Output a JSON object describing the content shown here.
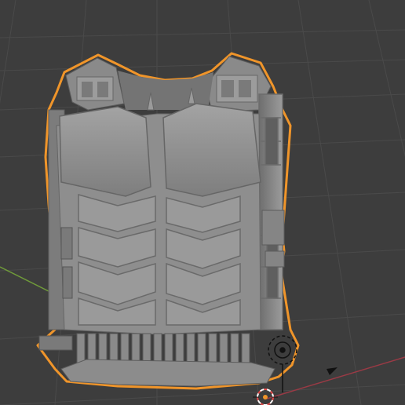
{
  "viewport": {
    "label": "3D Viewport",
    "background_color": "#3d3d3d",
    "grid_line_color": "#4a4a4a",
    "x_axis_color": "#9a3a45",
    "y_axis_color": "#6f9a3a",
    "selection_outline_color": "#f0952a",
    "active_object_state": "selected"
  },
  "object": {
    "kind": "vest-armor-mesh",
    "surface_color": "#8f8f8f",
    "shading": "solid"
  },
  "overlays": {
    "origin_icon": "3d-cursor-icon",
    "light_icon": "light-source-icon",
    "arrow_icon": "cursor-arrow-icon"
  }
}
